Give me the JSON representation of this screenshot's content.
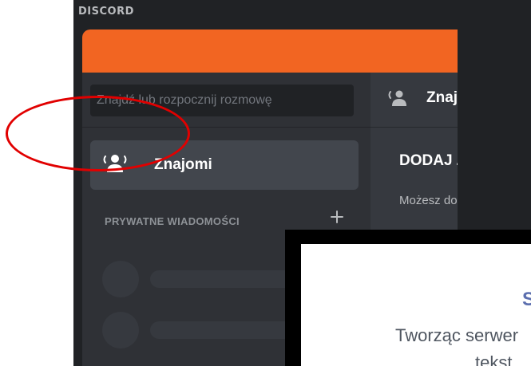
{
  "app": {
    "wordmark": "DISCORD"
  },
  "guild_bar": {
    "home_icon": "discord-logo-icon",
    "add_server_icon": "plus-icon",
    "explore_icon": "search-icon"
  },
  "dm_panel": {
    "search_placeholder": "Znajdź lub rozpocznij rozmowę",
    "friends_label": "Znajomi",
    "friends_icon": "wave-person-icon",
    "direct_messages_header": "PRYWATNE WIADOMOŚCI",
    "add_dm_icon": "plus-icon"
  },
  "main": {
    "tab_label": "Znajomi",
    "section_title": "DODAJ ZNAJOMEGO",
    "description": "Możesz dodać znajomego"
  },
  "modal": {
    "title": "S",
    "description_line1": "Tworząc serwer",
    "description_line2": "tekst"
  },
  "colors": {
    "accent": "#7289da",
    "banner": "#f26522",
    "positive": "#3ba55c",
    "annotation": "#e10000"
  }
}
